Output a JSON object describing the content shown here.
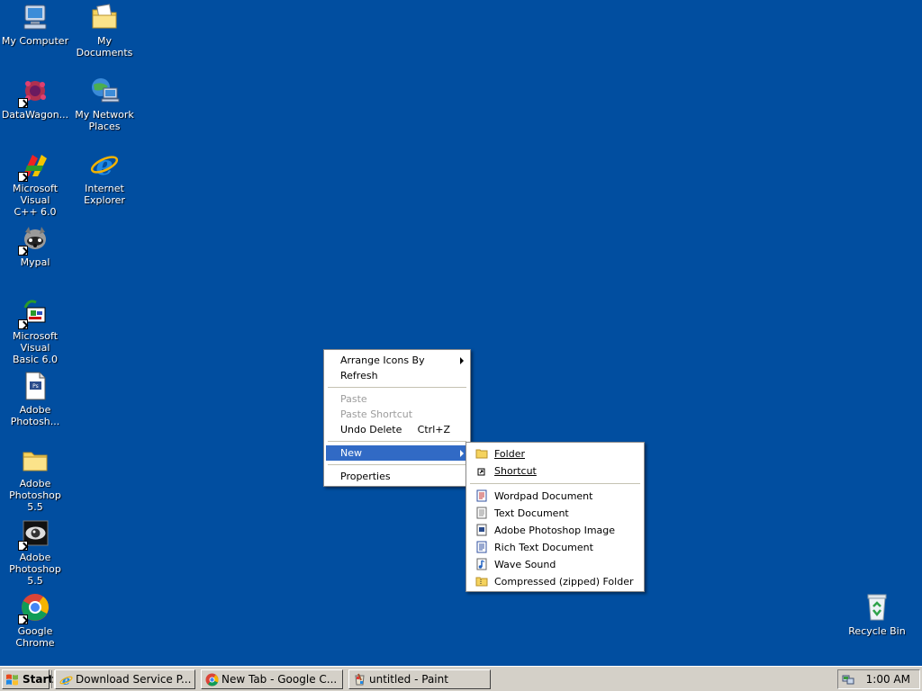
{
  "desktop": {
    "icons": [
      {
        "label": "My Computer",
        "icon": "my-computer-icon"
      },
      {
        "label": "My Documents",
        "icon": "my-documents-icon"
      },
      {
        "label": "DataWagon...",
        "icon": "datawagon-icon"
      },
      {
        "label": "My Network\nPlaces",
        "icon": "network-places-icon"
      },
      {
        "label": "Microsoft Visual\nC++ 6.0",
        "icon": "visual-cpp-icon"
      },
      {
        "label": "Internet\nExplorer",
        "icon": "internet-explorer-icon"
      },
      {
        "label": "Mypal",
        "icon": "mypal-icon"
      },
      {
        "label": "Microsoft Visual\nBasic 6.0",
        "icon": "visual-basic-icon"
      },
      {
        "label": "Adobe\nPhotosh...",
        "icon": "photoshop-file-icon"
      },
      {
        "label": "Adobe\nPhotoshop 5.5",
        "icon": "folder-icon"
      },
      {
        "label": "Adobe\nPhotoshop 5.5",
        "icon": "photoshop-eye-icon"
      },
      {
        "label": "Google Chrome",
        "icon": "chrome-icon"
      },
      {
        "label": "Recycle Bin",
        "icon": "recycle-bin-icon"
      }
    ]
  },
  "context_menu": {
    "items": [
      {
        "label": "Arrange Icons By",
        "has_submenu": true
      },
      {
        "label": "Refresh"
      },
      {
        "label": "Paste",
        "disabled": true
      },
      {
        "label": "Paste Shortcut",
        "disabled": true
      },
      {
        "label": "Undo Delete",
        "shortcut": "Ctrl+Z"
      },
      {
        "label": "New",
        "has_submenu": true,
        "selected": true
      },
      {
        "label": "Properties"
      }
    ]
  },
  "new_submenu": {
    "items": [
      {
        "label": "Folder",
        "icon": "folder-icon"
      },
      {
        "label": "Shortcut",
        "icon": "shortcut-icon"
      },
      {
        "label": "Wordpad Document",
        "icon": "wordpad-doc-icon"
      },
      {
        "label": "Text Document",
        "icon": "text-doc-icon"
      },
      {
        "label": "Adobe Photoshop Image",
        "icon": "photoshop-image-icon"
      },
      {
        "label": "Rich Text Document",
        "icon": "rich-text-doc-icon"
      },
      {
        "label": "Wave Sound",
        "icon": "wave-sound-icon"
      },
      {
        "label": "Compressed (zipped) Folder",
        "icon": "zip-folder-icon"
      }
    ]
  },
  "taskbar": {
    "start_label": "Start",
    "tasks": [
      {
        "label": "Download Service P...",
        "icon": "internet-explorer-icon"
      },
      {
        "label": "New Tab - Google C...",
        "icon": "chrome-icon"
      },
      {
        "label": "untitled - Paint",
        "icon": "paint-icon"
      }
    ],
    "clock": "1:00 AM"
  },
  "colors": {
    "desktop_bg": "#014ea0",
    "selection": "#316ac5",
    "taskbar": "#d4d0c8"
  }
}
